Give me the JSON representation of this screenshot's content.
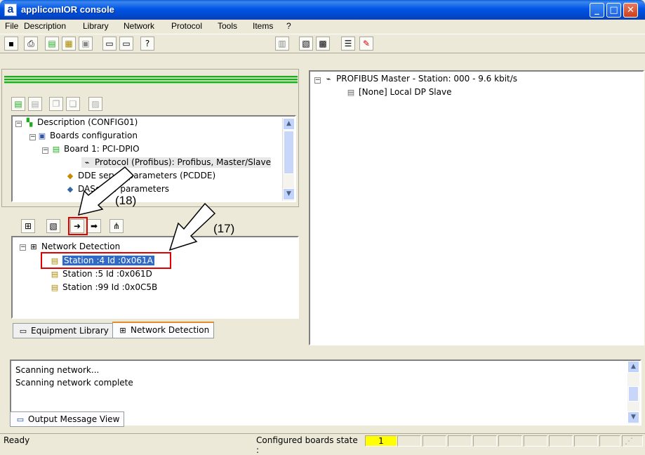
{
  "window": {
    "title": "applicomIOR console",
    "icon_letter": "a",
    "controls": [
      "minimize",
      "maximize",
      "close"
    ]
  },
  "menu": [
    {
      "label": "File"
    },
    {
      "label": "Description"
    },
    {
      "label": "Library"
    },
    {
      "label": "Network"
    },
    {
      "label": "Protocol"
    },
    {
      "label": "Tools"
    },
    {
      "label": "Items"
    },
    {
      "label": "?"
    }
  ],
  "description_tree": [
    {
      "label": "Description (CONFIG01)"
    },
    {
      "label": "Boards configuration"
    },
    {
      "label": "Board 1:   PCI-DPIO"
    },
    {
      "label": "Protocol (Profibus): Profibus, Master/Slave"
    },
    {
      "label": "DDE server parameters (PCDDE)"
    },
    {
      "label": "DAServer parameters"
    }
  ],
  "detection_tree": {
    "root": "Network Detection",
    "stations": [
      {
        "label": "Station :4 Id :0x061A",
        "selected": true
      },
      {
        "label": "Station :5 Id :0x061D",
        "selected": false
      },
      {
        "label": "Station :99 Id :0x0C5B",
        "selected": false
      }
    ]
  },
  "left_tabs": [
    {
      "label": "Equipment Library"
    },
    {
      "label": "Network Detection"
    }
  ],
  "network_tree": {
    "master": "PROFIBUS Master  - Station: 000 - 9.6 kbit/s",
    "slave": "[None]  Local DP Slave"
  },
  "output": {
    "lines": [
      "Scanning network...",
      "Scanning network complete"
    ],
    "tab_label": "Output Message View"
  },
  "statusbar": {
    "status": "Ready",
    "boards_state_label": "Configured boards state :",
    "boards_state_value": "1"
  },
  "annotations": {
    "label_18": "(18)",
    "label_17": "(17)"
  },
  "colors": {
    "title_bar": "#0055e5",
    "selection": "#316ac5",
    "highlight_box": "#e00000",
    "board_state": "#ffff00"
  }
}
